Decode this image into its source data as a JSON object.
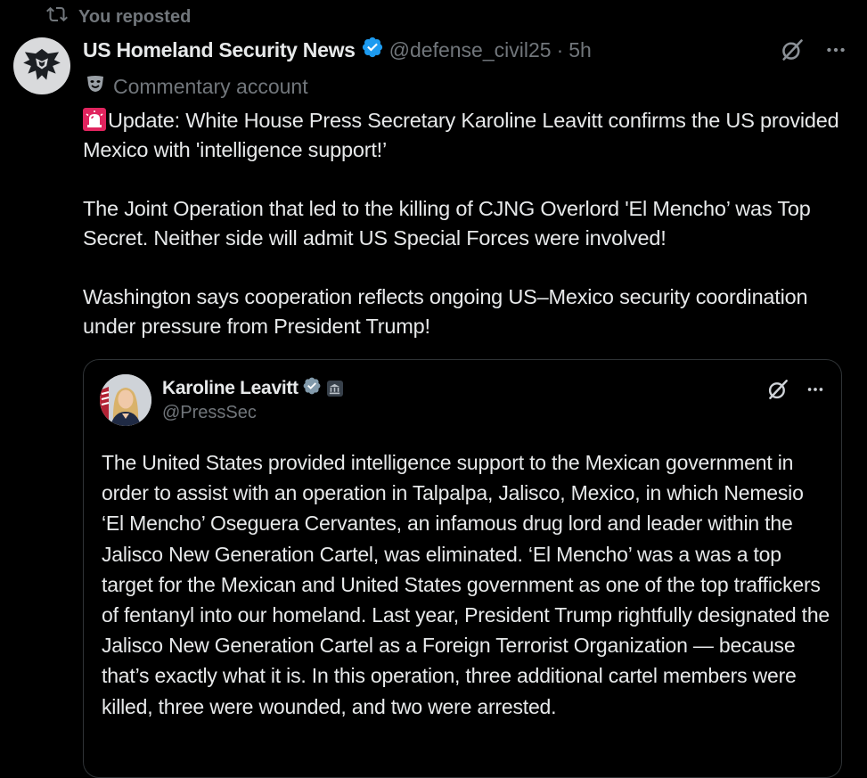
{
  "repost": {
    "label": "You reposted",
    "icon": "repost-icon"
  },
  "post": {
    "author_name": "US Homeland Security News",
    "handle": "@defense_civil25",
    "separator": "·",
    "time": "5h",
    "verified_color": "#1d9bf0",
    "commentary_label": "Commentary account",
    "commentary_icon": "theater-mask-icon",
    "text_lead_icon": "siren-icon",
    "paragraphs": [
      "Update: White House Press Secretary Karoline Leavitt confirms the US provided Mexico with 'intelligence support!’",
      "The Joint Operation that led to the killing of CJNG Overlord 'El Mencho’ was Top Secret. Neither side will admit US Special Forces were involved!",
      "Washington says cooperation reflects ongoing US–Mexico security coordination under pressure from President Trump!"
    ]
  },
  "quote": {
    "author_name": "Karoline Leavitt",
    "handle": "@PressSec",
    "verified_color": "#829aab",
    "badge_icon": "government-building-icon",
    "text": "The United States provided intelligence support to the Mexican government in order to assist with an operation in Talpalpa, Jalisco, Mexico, in which Nemesio ‘El Mencho’ Oseguera Cervantes, an infamous drug lord and leader within the Jalisco New Generation Cartel, was eliminated. ‘El Mencho’ was a was a top target for the Mexican and United States government as one of the top traffickers of fentanyl into our homeland. Last year, President Trump rightfully designated the Jalisco New Generation Cartel as a Foreign Terrorist Organization — because that’s exactly what it is. In this operation, three additional cartel members were killed, three were wounded, and two were arrested."
  },
  "colors": {
    "background": "#000000",
    "primary_text": "#e7e9ea",
    "secondary_text": "#71767b",
    "border": "#2f3336"
  }
}
